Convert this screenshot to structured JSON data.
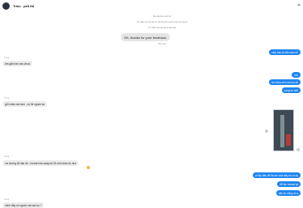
{
  "header": {
    "contact_name": "Triệu · ps5 fat"
  },
  "system_notes": [
    "Bạn đã được kết nối",
    "Tin nhắn mới sẽ hiển thị sau khi bạn trả lời cuộc trò chuyện",
    "Tin nhắn của bạn được bảo mật"
  ],
  "center_bubble": "OK, thanks for your feedback.",
  "divider_time": "Hôm nay",
  "messages": [
    {
      "dir": "out",
      "text": "mày bán ko liên bạn á?"
    },
    {
      "dir": "out",
      "text": "ừm"
    },
    {
      "dir": "out",
      "text": "nó chưa xem còn ko đc"
    },
    {
      "dir": "out",
      "text": "cung ko biết"
    },
    {
      "dir": "in",
      "sender": "Trung",
      "text": "tìm gắn hàn vào chưa"
    },
    {
      "dir": "in",
      "sender": "Trung",
      "text": "gửi video sai xem , có 4k nguồn ko"
    },
    {
      "dir": "in",
      "sender": "Trung",
      "text": "coi chừng lỗi hàn đó , format hàn sang hd 32 mới nhận dc nha"
    },
    {
      "dir": "out",
      "text": "ơi tây đâu để lâu thì nhả dây ko có ấy"
    },
    {
      "dir": "out",
      "text": "để lâu format lại"
    },
    {
      "dir": "out",
      "text": "dầu ko cũng có ạ"
    },
    {
      "dir": "in",
      "sender": "Trung",
      "text": "mình đây có nguồn mà sao ko ?"
    }
  ]
}
